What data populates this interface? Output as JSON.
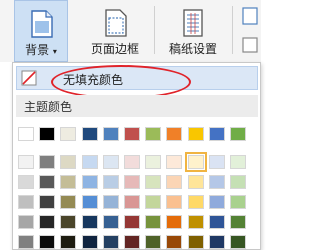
{
  "ribbon": {
    "background_label": "背景",
    "page_border_label": "页面边框",
    "paper_setup_label": "稿纸设置"
  },
  "dropdown": {
    "no_fill_label": "无填充颜色",
    "theme_colors_title": "主题颜色",
    "top_row": [
      "#ffffff",
      "#000000",
      "#eeece1",
      "#1f497d",
      "#4f81bd",
      "#c0504d",
      "#9bbb59",
      "#f08028",
      "#f9c600",
      "#4472c4",
      "#70ad47"
    ],
    "shade_grid": [
      [
        "#f2f2f2",
        "#7f7f7f",
        "#ddd9c4",
        "#c6d9f1",
        "#dce6f2",
        "#f2dcdb",
        "#ebf1de",
        "#fde9d9",
        "#fff2cc",
        "#dae3f3",
        "#e2f0d9"
      ],
      [
        "#d9d9d9",
        "#595959",
        "#c4bd97",
        "#8eb4e3",
        "#b9cde5",
        "#e6b9b8",
        "#d7e4bd",
        "#fbd5b5",
        "#ffe599",
        "#b4c7e7",
        "#c5e0b4"
      ],
      [
        "#bfbfbf",
        "#404040",
        "#948a54",
        "#558ed5",
        "#95b3d7",
        "#d99694",
        "#c3d69b",
        "#fac090",
        "#ffd966",
        "#8faadc",
        "#a9d18e"
      ],
      [
        "#a6a6a6",
        "#262626",
        "#4a452a",
        "#17375e",
        "#366092",
        "#953735",
        "#77933c",
        "#e46c0a",
        "#bf9000",
        "#2f5597",
        "#548235"
      ],
      [
        "#808080",
        "#0d0d0d",
        "#1e1c11",
        "#10243f",
        "#244062",
        "#632523",
        "#4f6228",
        "#984807",
        "#7f6000",
        "#1f3864",
        "#375623"
      ]
    ],
    "selected_color": "#fff2cc"
  },
  "colors": {
    "accent_highlight": "#e0232a",
    "ribbon_active": "#cde0f4",
    "no_fill_bg": "#dbe7f6"
  }
}
